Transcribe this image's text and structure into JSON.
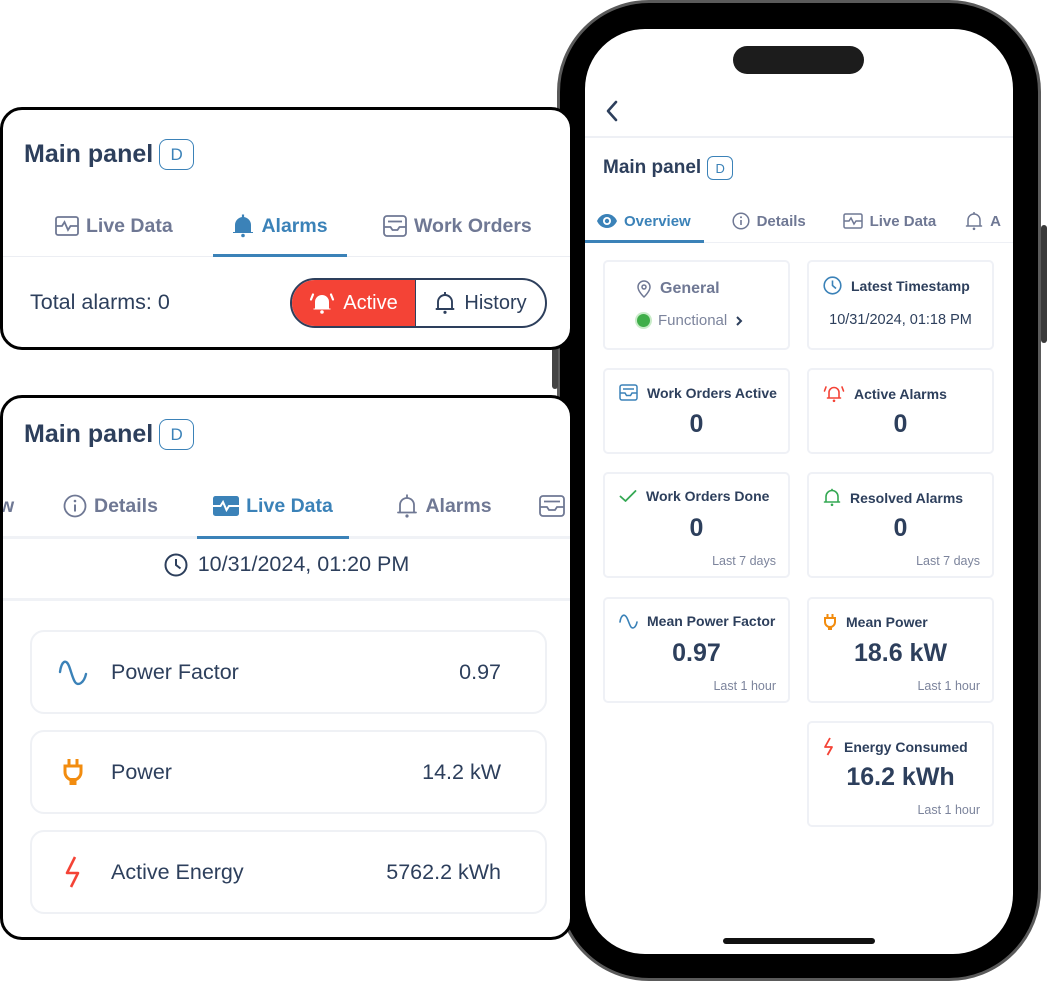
{
  "colors": {
    "accent": "#3b82b8",
    "text": "#2d3f5c",
    "muted": "#6f7894",
    "alarm_red": "#f44336",
    "power_orange": "#f28c0f",
    "success_green": "#34a853"
  },
  "phone": {
    "header": {
      "back_icon": "chevron-left-icon"
    },
    "title": "Main panel",
    "badge": "D",
    "tabs": [
      {
        "label": "Overview",
        "icon": "eye-icon",
        "active": true
      },
      {
        "label": "Details",
        "icon": "info-circle-icon",
        "active": false
      },
      {
        "label": "Live Data",
        "icon": "activity-icon",
        "active": false
      },
      {
        "label": "A",
        "icon": "bell-icon",
        "active": false
      }
    ],
    "cards": {
      "general": {
        "title": "General",
        "icon": "location-pin-icon",
        "status": "Functional",
        "status_color": "#34a853"
      },
      "latest_timestamp": {
        "title": "Latest Timestamp",
        "icon": "clock-icon",
        "value": "10/31/2024, 01:18 PM"
      },
      "work_orders_active": {
        "title": "Work Orders Active",
        "icon": "inbox-icon",
        "value": "0"
      },
      "active_alarms": {
        "title": "Active Alarms",
        "icon": "bell-ringing-icon",
        "value": "0"
      },
      "work_orders_done": {
        "title": "Work Orders Done",
        "icon": "check-icon",
        "value": "0",
        "period": "Last 7 days"
      },
      "resolved_alarms": {
        "title": "Resolved Alarms",
        "icon": "bell-icon",
        "value": "0",
        "period": "Last 7 days"
      },
      "mean_power_factor": {
        "title": "Mean Power Factor",
        "icon": "sine-wave-icon",
        "value": "0.97",
        "period": "Last 1 hour"
      },
      "mean_power": {
        "title": "Mean Power",
        "icon": "plug-icon",
        "value": "18.6 kW",
        "period": "Last 1 hour"
      },
      "energy_consumed": {
        "title": "Energy Consumed",
        "icon": "lightning-icon",
        "value": "16.2 kWh",
        "period": "Last 1 hour"
      }
    }
  },
  "alarms_panel": {
    "title": "Main panel",
    "badge": "D",
    "tabs": [
      {
        "label": "Live Data",
        "icon": "activity-icon",
        "active": false
      },
      {
        "label": "Alarms",
        "icon": "bell-filled-icon",
        "active": true
      },
      {
        "label": "Work Orders",
        "icon": "inbox-icon",
        "active": false
      }
    ],
    "total_alarms_label": "Total alarms: 0",
    "segment": {
      "active_label": "Active",
      "history_label": "History",
      "selected": "Active"
    }
  },
  "live_panel": {
    "title": "Main panel",
    "badge": "D",
    "tabs": [
      {
        "label": "w",
        "icon": "",
        "active": false
      },
      {
        "label": "Details",
        "icon": "info-circle-icon",
        "active": false
      },
      {
        "label": "Live Data",
        "icon": "activity-filled-icon",
        "active": true
      },
      {
        "label": "Alarms",
        "icon": "bell-icon",
        "active": false
      },
      {
        "label": "",
        "icon": "inbox-icon",
        "active": false
      }
    ],
    "timestamp": "10/31/2024, 01:20 PM",
    "metrics": [
      {
        "label": "Power Factor",
        "value": "0.97",
        "icon": "sine-wave-icon"
      },
      {
        "label": "Power",
        "value": "14.2 kW",
        "icon": "plug-icon"
      },
      {
        "label": "Active Energy",
        "value": "5762.2 kWh",
        "icon": "lightning-icon"
      }
    ]
  }
}
